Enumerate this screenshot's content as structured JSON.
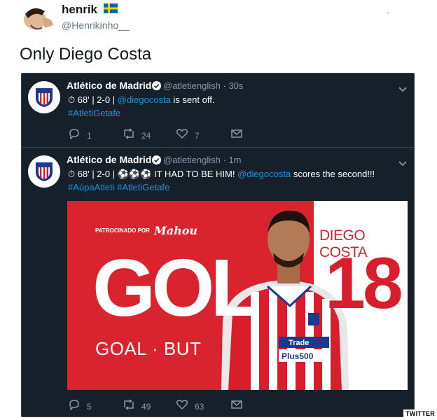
{
  "outer": {
    "name": "henrik",
    "handle": "@Henrikinho__",
    "text": "Only Diego Costa"
  },
  "quoted": [
    {
      "account_name": "Atlético de Madrid",
      "handle": "@atletienglish",
      "sep": "·",
      "time": "30s",
      "line1_prefix": "68' | 2-0 |",
      "line1_link": "@diegocosta",
      "line1_suffix": "is sent off.",
      "hashtags": "#AtletiGetafe",
      "replies": "1",
      "retweets": "24",
      "likes": "7"
    },
    {
      "account_name": "Atlético de Madrid",
      "handle": "@atletienglish",
      "sep": "·",
      "time": "1m",
      "line1_prefix": "68' | 2-0 |",
      "line1_mid": "IT HAD TO BE HIM!",
      "line1_link": "@diegocosta",
      "line1_suffix": "scores the second!!!",
      "hashtags": "#AúpaAtleti #AtletiGetafe",
      "replies": "5",
      "retweets": "49",
      "likes": "63"
    }
  ],
  "image": {
    "sponsor_label": "PATROCINADO POR",
    "sponsor_brand": "Mahou",
    "big_word": "GOL",
    "sub_text": "GOAL · BUT",
    "player_name": "DIEGO COSTA",
    "number": "18",
    "shirt_sponsor_1": "Trade",
    "shirt_sponsor_2": "Plus500"
  },
  "badge": "TWITTER",
  "colors": {
    "card_bg": "#15202b",
    "link": "#1b95e0",
    "atm_red": "#d81e2c"
  }
}
